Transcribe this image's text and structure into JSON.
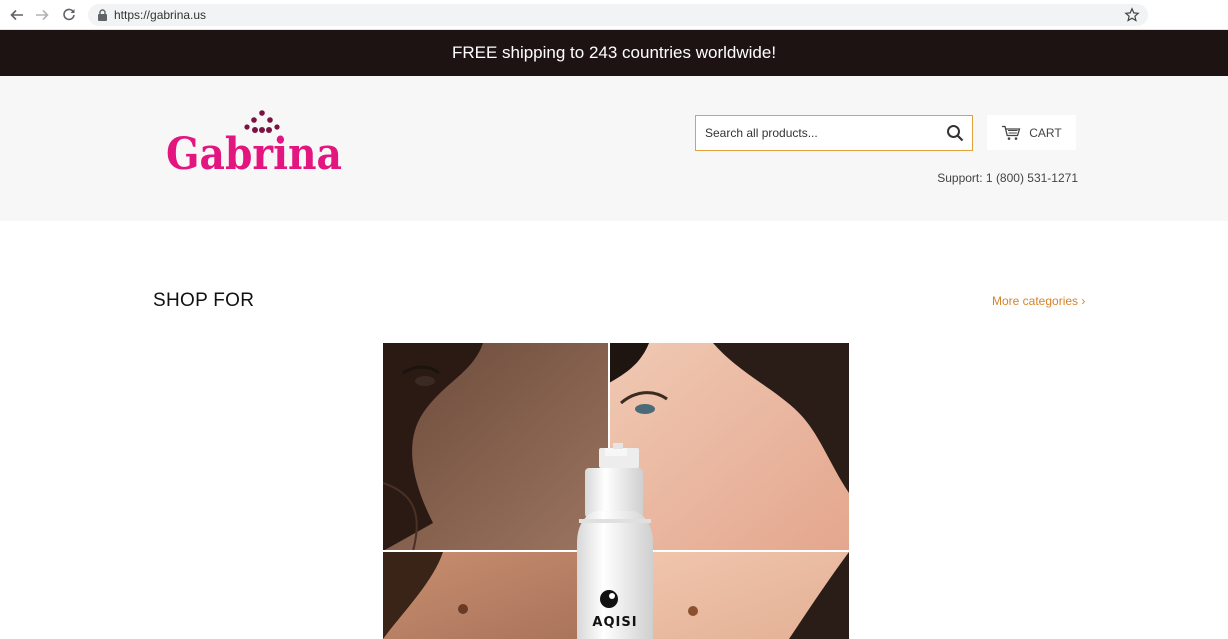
{
  "browser": {
    "url": "https://gabrina.us"
  },
  "announcement": {
    "text": "FREE shipping to 243 countries worldwide!"
  },
  "header": {
    "logo_text": "Gabrina",
    "search_placeholder": "Search all products...",
    "cart_label": "CART",
    "support_text": "Support: 1 (800) 531-1271"
  },
  "main": {
    "section_title": "SHOP FOR",
    "more_link": "More categories ›",
    "hero_product_brand": "AQISI"
  },
  "colors": {
    "announcement_bg": "#1e1313",
    "logo_pink": "#e3157f",
    "logo_dots": "#7a1340",
    "accent_orange": "#d4842a",
    "search_border": "#e0a23b"
  }
}
